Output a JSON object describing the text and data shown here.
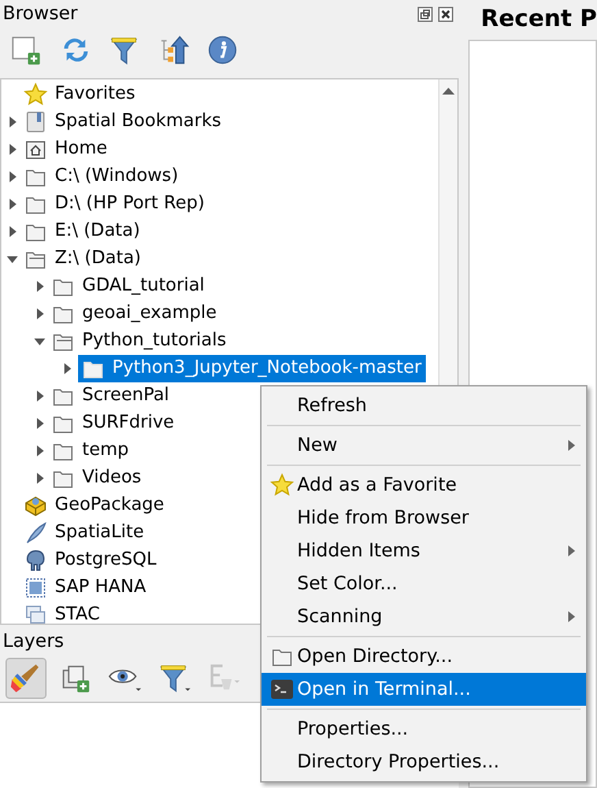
{
  "browser_panel": {
    "title": "Browser",
    "toolbar": [
      {
        "kind": "add"
      },
      {
        "kind": "refresh"
      },
      {
        "kind": "filter"
      },
      {
        "kind": "collapse"
      },
      {
        "kind": "info"
      }
    ],
    "tree": [
      {
        "label": "Favorites",
        "kind": "star",
        "selected": false
      },
      {
        "label": "Spatial Bookmarks",
        "kind": "bookmark",
        "expanded": false,
        "selected": false
      },
      {
        "label": "Home",
        "kind": "home",
        "expanded": false,
        "selected": false
      },
      {
        "label": "C:\\ (Windows)",
        "kind": "folder",
        "expanded": false,
        "selected": false
      },
      {
        "label": "D:\\ (HP Port Rep)",
        "kind": "folder",
        "expanded": false,
        "selected": false
      },
      {
        "label": "E:\\ (Data)",
        "kind": "folder",
        "expanded": false,
        "selected": false
      },
      {
        "label": "Z:\\ (Data)",
        "kind": "folder",
        "expanded": true,
        "selected": false,
        "children": [
          {
            "label": "GDAL_tutorial",
            "kind": "folder",
            "expanded": false,
            "selected": false
          },
          {
            "label": "geoai_example",
            "kind": "folder",
            "expanded": false,
            "selected": false
          },
          {
            "label": "Python_tutorials",
            "kind": "folder",
            "expanded": true,
            "selected": false,
            "children": [
              {
                "label": "Python3_Jupyter_Notebook-master",
                "kind": "folder",
                "expanded": false,
                "selected": true
              }
            ]
          },
          {
            "label": "ScreenPal",
            "kind": "folder",
            "expanded": false,
            "selected": false
          },
          {
            "label": "SURFdrive",
            "kind": "folder",
            "expanded": false,
            "selected": false
          },
          {
            "label": "temp",
            "kind": "folder",
            "expanded": false,
            "selected": false
          },
          {
            "label": "Videos",
            "kind": "folder",
            "expanded": false,
            "selected": false
          }
        ]
      },
      {
        "label": "GeoPackage",
        "kind": "geopackage",
        "selected": false
      },
      {
        "label": "SpatiaLite",
        "kind": "feather",
        "selected": false
      },
      {
        "label": "PostgreSQL",
        "kind": "elephant",
        "selected": false
      },
      {
        "label": "SAP HANA",
        "kind": "database",
        "selected": false
      },
      {
        "label": "STAC",
        "kind": "stack",
        "selected": false
      }
    ]
  },
  "layers_panel": {
    "title": "Layers",
    "toolbar": [
      {
        "kind": "brush",
        "pressed": true,
        "disabled": false
      },
      {
        "kind": "add-group",
        "pressed": false,
        "disabled": false
      },
      {
        "kind": "eye",
        "pressed": false,
        "disabled": false
      },
      {
        "kind": "filter",
        "pressed": false,
        "disabled": false
      },
      {
        "kind": "epsilon",
        "pressed": false,
        "disabled": true
      }
    ]
  },
  "recent_projects": {
    "title": "Recent P"
  },
  "context_menu": [
    {
      "kind": "item",
      "label": "Refresh",
      "submenu": false,
      "selected": false
    },
    {
      "kind": "separator"
    },
    {
      "kind": "item",
      "label": "New",
      "submenu": true,
      "selected": false
    },
    {
      "kind": "separator"
    },
    {
      "kind": "star",
      "label": "Add as a Favorite",
      "submenu": false,
      "selected": false
    },
    {
      "kind": "item",
      "label": "Hide from Browser",
      "submenu": false,
      "selected": false
    },
    {
      "kind": "item",
      "label": "Hidden Items",
      "submenu": true,
      "selected": false
    },
    {
      "kind": "item",
      "label": "Set Color...",
      "submenu": false,
      "selected": false
    },
    {
      "kind": "item",
      "label": "Scanning",
      "submenu": true,
      "selected": false
    },
    {
      "kind": "separator"
    },
    {
      "kind": "folder",
      "label": "Open Directory...",
      "submenu": false,
      "selected": false
    },
    {
      "kind": "terminal",
      "label": "Open in Terminal...",
      "submenu": false,
      "selected": true
    },
    {
      "kind": "separator"
    },
    {
      "kind": "item",
      "label": "Properties...",
      "submenu": false,
      "selected": false
    },
    {
      "kind": "item",
      "label": "Directory Properties...",
      "submenu": false,
      "selected": false
    }
  ]
}
